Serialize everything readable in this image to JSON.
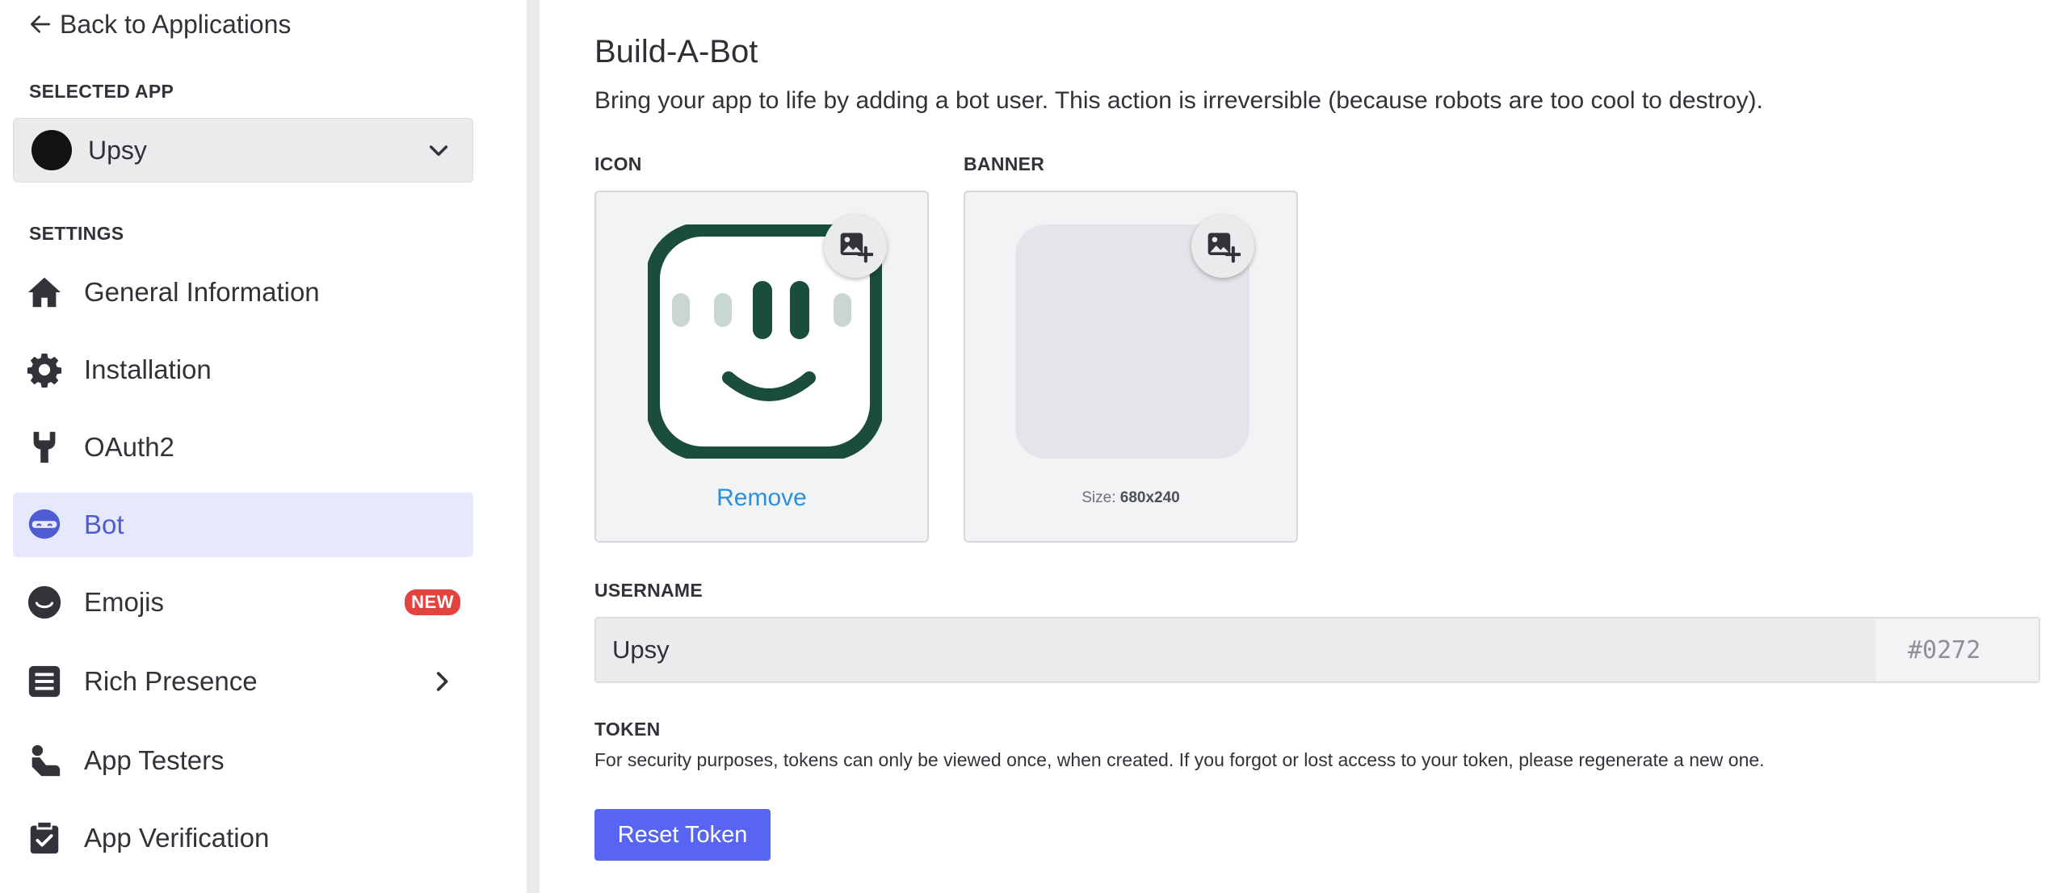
{
  "sidebar": {
    "back_label": "Back to Applications",
    "selected_app_heading": "SELECTED APP",
    "selected_app_name": "Upsy",
    "settings_heading": "SETTINGS",
    "items": [
      {
        "label": "General Information",
        "icon": "home-icon"
      },
      {
        "label": "Installation",
        "icon": "gear-icon"
      },
      {
        "label": "OAuth2",
        "icon": "wrench-icon"
      },
      {
        "label": "Bot",
        "icon": "bot-icon",
        "active": true
      },
      {
        "label": "Emojis",
        "icon": "emoji-icon",
        "badge": "NEW"
      },
      {
        "label": "Rich Presence",
        "icon": "list-icon",
        "expandable": true
      },
      {
        "label": "App Testers",
        "icon": "tester-icon"
      },
      {
        "label": "App Verification",
        "icon": "clipboard-check-icon"
      }
    ]
  },
  "main": {
    "title": "Build-A-Bot",
    "description": "Bring your app to life by adding a bot user. This action is irreversible (because robots are too cool to destroy).",
    "icon_label": "ICON",
    "banner_label": "BANNER",
    "remove_label": "Remove",
    "banner_size_prefix": "Size: ",
    "banner_size": "680x240",
    "username_label": "USERNAME",
    "username_value": "Upsy",
    "discriminator": "#0272",
    "token_label": "TOKEN",
    "token_description": "For security purposes, tokens can only be viewed once, when created. If you forgot or lost access to your token, please regenerate a new one.",
    "reset_button": "Reset Token"
  },
  "colors": {
    "accent": "#5865f2",
    "active_nav_bg": "#e6e8fd",
    "badge": "#e2433f",
    "link": "#2d8fd9",
    "bot_icon_green": "#1b4d3e"
  }
}
